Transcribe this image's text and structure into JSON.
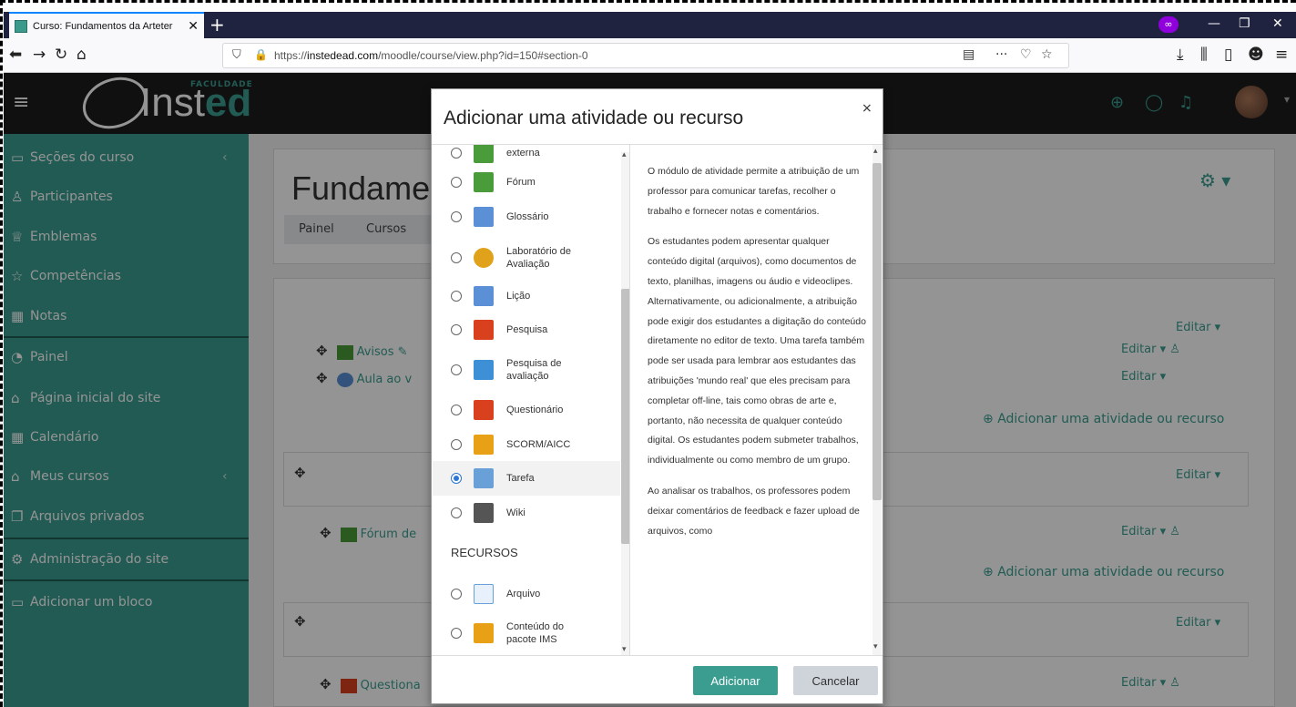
{
  "browser": {
    "tab_title": "Curso: Fundamentos da Arteter",
    "url_prefix": "https://",
    "url_domain": "instedead.com",
    "url_path": "/moodle/course/view.php?id=150#section-0"
  },
  "header": {
    "logo_text": "Inst",
    "logo_accent": "ed",
    "logo_tag": "FACULDADE"
  },
  "sidebar": {
    "items": [
      {
        "label": "Seções do curso",
        "icon": "folder-icon"
      },
      {
        "label": "Participantes",
        "icon": "users-icon"
      },
      {
        "label": "Emblemas",
        "icon": "badge-icon"
      },
      {
        "label": "Competências",
        "icon": "star-icon"
      },
      {
        "label": "Notas",
        "icon": "grades-icon"
      },
      {
        "label": "Painel",
        "icon": "dashboard-icon"
      },
      {
        "label": "Página inicial do site",
        "icon": "home-icon"
      },
      {
        "label": "Calendário",
        "icon": "calendar-icon"
      },
      {
        "label": "Meus cursos",
        "icon": "courses-icon"
      },
      {
        "label": "Arquivos privados",
        "icon": "files-icon"
      },
      {
        "label": "Administração do site",
        "icon": "gear-icon"
      },
      {
        "label": "Adicionar um bloco",
        "icon": "add-block-icon"
      }
    ]
  },
  "course": {
    "title": "Fundame",
    "breadcrumb": [
      "Painel",
      "Cursos"
    ],
    "activities": [
      "Avisos",
      "Aula ao v",
      "Fórum de",
      "Questiona"
    ],
    "edit_label": "Editar ▾",
    "add_activity_label": "Adicionar uma atividade ou recurso"
  },
  "modal": {
    "title": "Adicionar uma atividade ou recurso",
    "close": "×",
    "options": [
      {
        "label": "externa",
        "color": "#4a9c3a"
      },
      {
        "label": "Fórum",
        "color": "#4a9c3a"
      },
      {
        "label": "Glossário",
        "color": "#5b8fd6"
      },
      {
        "label": "Laboratório de Avaliação",
        "color": "#e0a21a"
      },
      {
        "label": "Lição",
        "color": "#5b8fd6"
      },
      {
        "label": "Pesquisa",
        "color": "#d9411e"
      },
      {
        "label": "Pesquisa de avaliação",
        "color": "#3d8fd6"
      },
      {
        "label": "Questionário",
        "color": "#d9411e"
      },
      {
        "label": "SCORM/AICC",
        "color": "#e8a116"
      },
      {
        "label": "Tarefa",
        "color": "#6aa0d8"
      },
      {
        "label": "Wiki",
        "color": "#555555"
      }
    ],
    "resources_heading": "RECURSOS",
    "resources": [
      {
        "label": "Arquivo",
        "color": "#6aa0d8"
      },
      {
        "label": "Conteúdo do pacote IMS",
        "color": "#e8a116"
      }
    ],
    "selected": "Tarefa",
    "description": [
      "O módulo de atividade permite a atribuição de um professor para comunicar tarefas, recolher o trabalho e fornecer notas e comentários.",
      "Os estudantes podem apresentar qualquer conteúdo digital (arquivos), como documentos de texto, planilhas, imagens ou áudio e videoclipes. Alternativamente, ou adicionalmente, a atribuição pode exigir dos estudantes a digitação do conteúdo diretamente no editor de texto. Uma tarefa também pode ser usada para lembrar aos estudantes das atribuições 'mundo real' que eles precisam para completar off-line, tais como obras de arte e, portanto, não necessita de qualquer conteúdo digital. Os estudantes podem submeter trabalhos, individualmente ou como membro de um grupo.",
      "Ao analisar os trabalhos, os professores podem deixar comentários de feedback e fazer upload de arquivos, como"
    ],
    "add_button": "Adicionar",
    "cancel_button": "Cancelar"
  },
  "colors": {
    "accent": "#3a9d90",
    "header_bg": "#1d1d1d"
  }
}
